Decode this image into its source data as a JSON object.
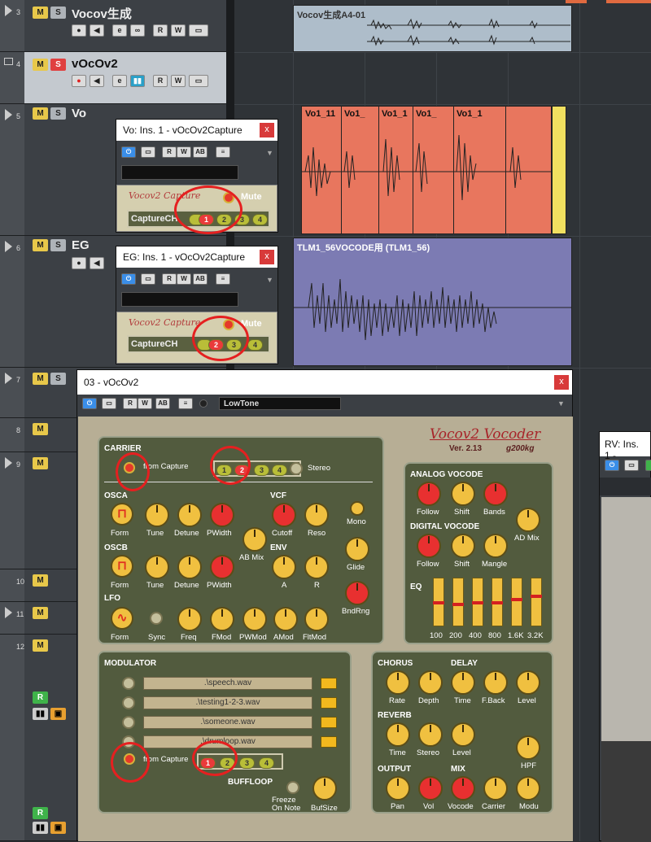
{
  "tracks": [
    {
      "num": "3",
      "name": "Vocov生成"
    },
    {
      "num": "4",
      "name": "vOcOv2"
    },
    {
      "num": "5",
      "name": "Vo"
    },
    {
      "num": "6",
      "name": "EG"
    },
    {
      "num": "7",
      "name": ""
    },
    {
      "num": "8",
      "name": ""
    },
    {
      "num": "9",
      "name": ""
    },
    {
      "num": "10",
      "name": ""
    },
    {
      "num": "11",
      "name": ""
    },
    {
      "num": "12",
      "name": ""
    }
  ],
  "btn": {
    "m": "M",
    "s": "S",
    "r": "R",
    "w": "W",
    "e": "e"
  },
  "clips": {
    "c1": "Vocov生成A4-01",
    "c2a": "Vo1_11",
    "c2b": "Vo1_",
    "c2c": "Vo1_1",
    "c2d": "Vo1_",
    "c2e": "Vo1_1",
    "c4": "TLM1_56VOCODE用 (TLM1_56)"
  },
  "win_vo": {
    "title": "Vo: Ins. 1 - vOcOv2Capture"
  },
  "win_eg": {
    "title": "EG: Ins. 1 - vOcOv2Capture"
  },
  "win_main": {
    "title": "03 - vOcOv2",
    "preset": "LowTone"
  },
  "win_rv": {
    "title": "RV: Ins. 1 -"
  },
  "close": "x",
  "capture": {
    "logo": "Vocov2 Capture",
    "mute": "Mute",
    "ch_label": "CaptureCH",
    "ch": [
      "1",
      "2",
      "3",
      "4"
    ]
  },
  "plugin": {
    "logo": "Vocov2 Vocoder",
    "ver": "Ver. 2.13",
    "brand": "g200kg",
    "carrier": "CARRIER",
    "from_capture": "from Capture",
    "stereo": "Stereo",
    "osca": "OSCA",
    "oscb": "OSCB",
    "vcf": "VCF",
    "env": "ENV",
    "lfo": "LFO",
    "form": "Form",
    "tune": "Tune",
    "detune": "Detune",
    "pwidth": "PWidth",
    "ab_mix": "AB Mix",
    "cutoff": "Cutoff",
    "reso": "Reso",
    "a": "A",
    "r": "R",
    "mono": "Mono",
    "glide": "Glide",
    "bndrng": "BndRng",
    "sync": "Sync",
    "freq": "Freq",
    "fmod": "FMod",
    "pwmod": "PWMod",
    "amod": "AMod",
    "fltmod": "FltMod",
    "analog": "ANALOG VOCODE",
    "follow": "Follow",
    "shift": "Shift",
    "bands": "Bands",
    "ad_mix": "AD Mix",
    "digital": "DIGITAL VOCODE",
    "mangle": "Mangle",
    "eq": "EQ",
    "eq_bands": [
      "100",
      "200",
      "400",
      "800",
      "1.6K",
      "3.2K"
    ],
    "modulator": "MODULATOR",
    "files": [
      ".\\speech.wav",
      ".\\testing1-2-3.wav",
      ".\\someone.wav",
      ".\\drumloop.wav"
    ],
    "buffloop": "BUFFLOOP",
    "freeze": "Freeze",
    "on_note": "On Note",
    "bufsize": "BufSize",
    "chorus": "CHORUS",
    "delay": "DELAY",
    "rate": "Rate",
    "depth": "Depth",
    "time": "Time",
    "fback": "F.Back",
    "level": "Level",
    "reverb": "REVERB",
    "stereo_k": "Stereo",
    "hpf": "HPF",
    "output": "OUTPUT",
    "mix": "MIX",
    "pan": "Pan",
    "vol": "Vol",
    "vocode": "Vocode",
    "carrier_k": "Carrier",
    "modu": "Modu"
  }
}
